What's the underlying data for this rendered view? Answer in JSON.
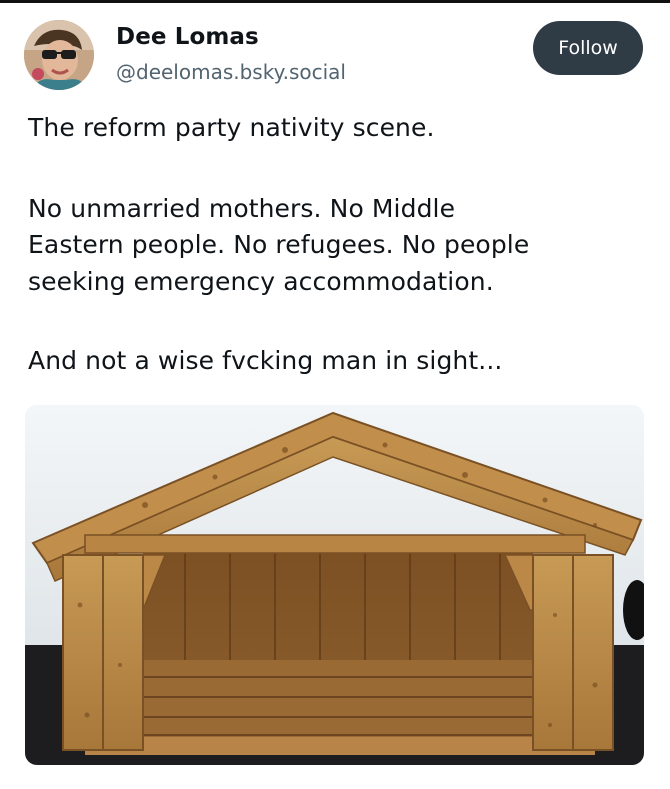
{
  "author": {
    "display_name": "Dee Lomas",
    "handle": "@deelomas.bsky.social",
    "avatar_icon": "user-avatar-sunglasses"
  },
  "actions": {
    "follow_label": "Follow"
  },
  "post": {
    "lines": [
      "The reform party nativity scene.",
      "No unmarried mothers. No Middle",
      "Eastern people. No refugees. No people",
      "seeking emergency accommodation.",
      "And not a wise fvcking man in sight..."
    ]
  },
  "media": {
    "description_icon": "empty-wooden-nativity-stable-image"
  },
  "colors": {
    "follow_button_bg": "#2f3b45",
    "handle_text": "#536471",
    "body_text": "#0f1419"
  }
}
